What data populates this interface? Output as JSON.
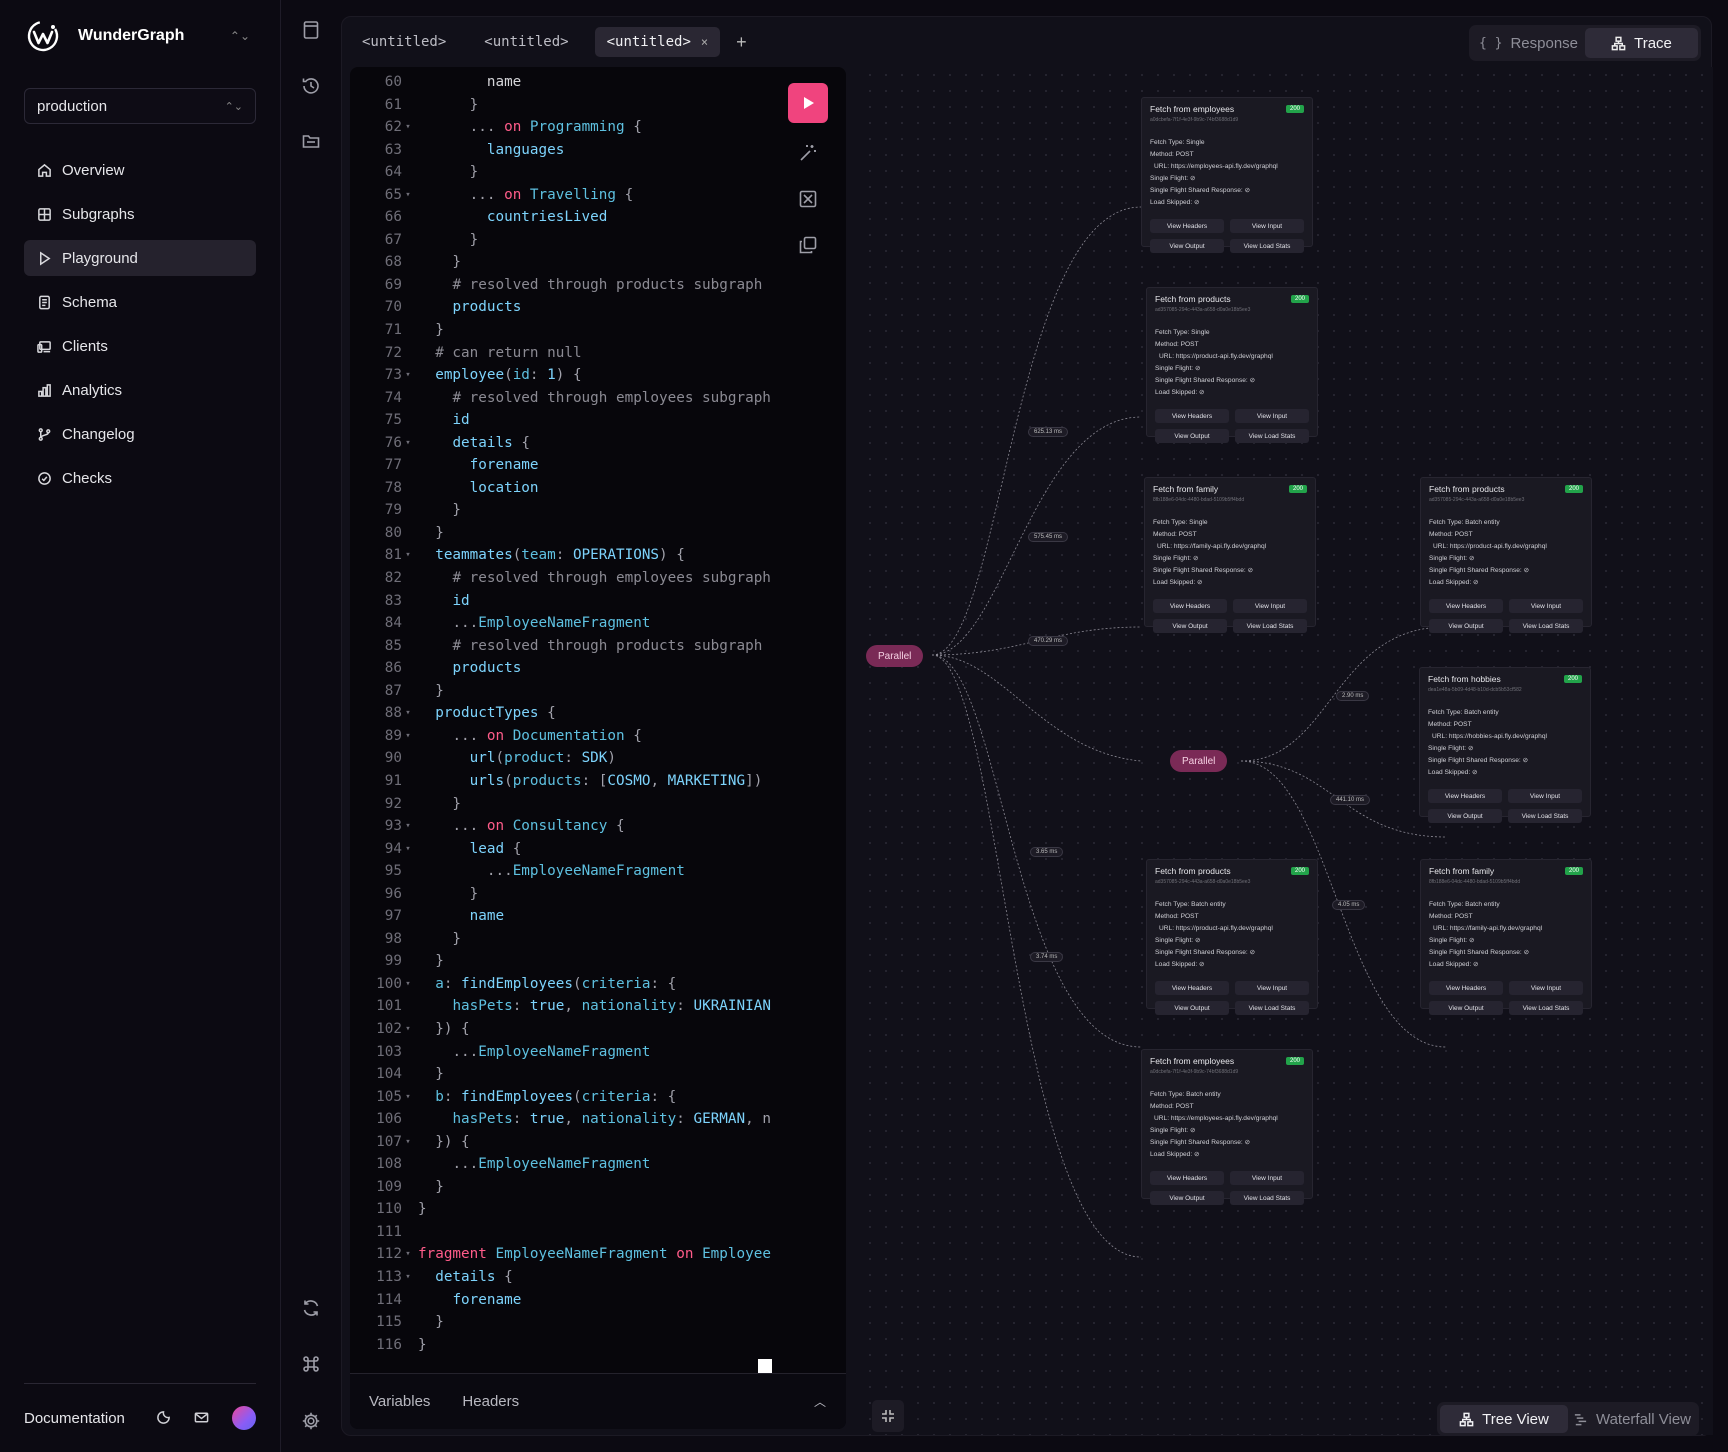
{
  "brand": {
    "name": "WunderGraph"
  },
  "environment": {
    "selected": "production"
  },
  "nav": [
    {
      "label": "Overview",
      "icon": "home-icon"
    },
    {
      "label": "Subgraphs",
      "icon": "grid-icon"
    },
    {
      "label": "Playground",
      "icon": "play-icon",
      "active": true
    },
    {
      "label": "Schema",
      "icon": "document-icon"
    },
    {
      "label": "Clients",
      "icon": "devices-icon"
    },
    {
      "label": "Analytics",
      "icon": "bar-chart-icon"
    },
    {
      "label": "Changelog",
      "icon": "git-branch-icon"
    },
    {
      "label": "Checks",
      "icon": "check-circle-icon"
    }
  ],
  "footer": {
    "documentation": "Documentation"
  },
  "tabs": [
    {
      "label": "<untitled>"
    },
    {
      "label": "<untitled>"
    },
    {
      "label": "<untitled>",
      "active": true,
      "close": "×"
    }
  ],
  "tab_add": "+",
  "result_toggle": {
    "response": "Response",
    "response_icon": "{ }",
    "trace": "Trace",
    "active": "Trace"
  },
  "editor": {
    "lines": [
      {
        "n": "60",
        "fold": false,
        "html": "<span class='p'>        name</span>"
      },
      {
        "n": "61",
        "fold": false,
        "html": "<span class='b'>      }</span>"
      },
      {
        "n": "62",
        "fold": true,
        "html": "      <span class='b'>... </span><span class='k'>on</span> <span class='f'>Programming</span> <span class='b'>{</span>"
      },
      {
        "n": "63",
        "fold": false,
        "html": "        <span class='t'>languages</span>"
      },
      {
        "n": "64",
        "fold": false,
        "html": "<span class='b'>      }</span>"
      },
      {
        "n": "65",
        "fold": true,
        "html": "      <span class='b'>... </span><span class='k'>on</span> <span class='f'>Travelling</span> <span class='b'>{</span>"
      },
      {
        "n": "66",
        "fold": false,
        "html": "        <span class='t'>countriesLived</span>"
      },
      {
        "n": "67",
        "fold": false,
        "html": "<span class='b'>      }</span>"
      },
      {
        "n": "68",
        "fold": false,
        "html": "<span class='b'>    }</span>"
      },
      {
        "n": "69",
        "fold": false,
        "html": "    <span class='c'># resolved through products subgraph</span>"
      },
      {
        "n": "70",
        "fold": false,
        "html": "    <span class='t'>products</span>"
      },
      {
        "n": "71",
        "fold": false,
        "html": "<span class='b'>  }</span>"
      },
      {
        "n": "72",
        "fold": false,
        "html": "  <span class='c'># can return null</span>"
      },
      {
        "n": "73",
        "fold": true,
        "html": "  <span class='t'>employee</span><span class='b'>(</span><span class='f'>id</span><span class='b'>: </span><span class='t'>1</span><span class='b'>) {</span>"
      },
      {
        "n": "74",
        "fold": false,
        "html": "    <span class='c'># resolved through employees subgraph</span>"
      },
      {
        "n": "75",
        "fold": false,
        "html": "    <span class='t'>id</span>"
      },
      {
        "n": "76",
        "fold": true,
        "html": "    <span class='t'>details</span> <span class='b'>{</span>"
      },
      {
        "n": "77",
        "fold": false,
        "html": "      <span class='t'>forename</span>"
      },
      {
        "n": "78",
        "fold": false,
        "html": "      <span class='t'>location</span>"
      },
      {
        "n": "79",
        "fold": false,
        "html": "<span class='b'>    }</span>"
      },
      {
        "n": "80",
        "fold": false,
        "html": "<span class='b'>  }</span>"
      },
      {
        "n": "81",
        "fold": true,
        "html": "  <span class='t'>teammates</span><span class='b'>(</span><span class='f'>team</span><span class='b'>: </span><span class='t'>OPERATIONS</span><span class='b'>) {</span>"
      },
      {
        "n": "82",
        "fold": false,
        "html": "    <span class='c'># resolved through employees subgraph</span>"
      },
      {
        "n": "83",
        "fold": false,
        "html": "    <span class='t'>id</span>"
      },
      {
        "n": "84",
        "fold": false,
        "html": "    <span class='b'>...</span><span class='f'>EmployeeNameFragment</span>"
      },
      {
        "n": "85",
        "fold": false,
        "html": "    <span class='c'># resolved through products subgraph</span>"
      },
      {
        "n": "86",
        "fold": false,
        "html": "    <span class='t'>products</span>"
      },
      {
        "n": "87",
        "fold": false,
        "html": "<span class='b'>  }</span>"
      },
      {
        "n": "88",
        "fold": true,
        "html": "  <span class='t'>productTypes</span> <span class='b'>{</span>"
      },
      {
        "n": "89",
        "fold": true,
        "html": "    <span class='b'>... </span><span class='k'>on</span> <span class='f'>Documentation</span> <span class='b'>{</span>"
      },
      {
        "n": "90",
        "fold": false,
        "html": "      <span class='t'>url</span><span class='b'>(</span><span class='f'>product</span><span class='b'>: </span><span class='t'>SDK</span><span class='b'>)</span>"
      },
      {
        "n": "91",
        "fold": false,
        "html": "      <span class='t'>urls</span><span class='b'>(</span><span class='f'>products</span><span class='b'>: [</span><span class='t'>COSMO</span><span class='b'>, </span><span class='t'>MARKETING</span><span class='b'>])</span>"
      },
      {
        "n": "92",
        "fold": false,
        "html": "<span class='b'>    }</span>"
      },
      {
        "n": "93",
        "fold": true,
        "html": "    <span class='b'>... </span><span class='k'>on</span> <span class='f'>Consultancy</span> <span class='b'>{</span>"
      },
      {
        "n": "94",
        "fold": true,
        "html": "      <span class='t'>lead</span> <span class='b'>{</span>"
      },
      {
        "n": "95",
        "fold": false,
        "html": "        <span class='b'>...</span><span class='f'>EmployeeNameFragment</span>"
      },
      {
        "n": "96",
        "fold": false,
        "html": "<span class='b'>      }</span>"
      },
      {
        "n": "97",
        "fold": false,
        "html": "      <span class='t'>name</span>"
      },
      {
        "n": "98",
        "fold": false,
        "html": "<span class='b'>    }</span>"
      },
      {
        "n": "99",
        "fold": false,
        "html": "<span class='b'>  }</span>"
      },
      {
        "n": "100",
        "fold": true,
        "html": "  <span class='f'>a</span><span class='b'>: </span><span class='t'>findEmployees</span><span class='b'>(</span><span class='f'>criteria</span><span class='b'>: {</span>"
      },
      {
        "n": "101",
        "fold": false,
        "html": "    <span class='f'>hasPets</span><span class='b'>: </span><span class='t'>true</span><span class='b'>, </span><span class='f'>nationality</span><span class='b'>: </span><span class='t'>UKRAINIAN</span>"
      },
      {
        "n": "102",
        "fold": true,
        "html": "<span class='b'>  }) {</span>"
      },
      {
        "n": "103",
        "fold": false,
        "html": "    <span class='b'>...</span><span class='f'>EmployeeNameFragment</span>"
      },
      {
        "n": "104",
        "fold": false,
        "html": "<span class='b'>  }</span>"
      },
      {
        "n": "105",
        "fold": true,
        "html": "  <span class='f'>b</span><span class='b'>: </span><span class='t'>findEmployees</span><span class='b'>(</span><span class='f'>criteria</span><span class='b'>: {</span>"
      },
      {
        "n": "106",
        "fold": false,
        "html": "    <span class='f'>hasPets</span><span class='b'>: </span><span class='t'>true</span><span class='b'>, </span><span class='f'>nationality</span><span class='b'>: </span><span class='t'>GERMAN</span><span class='b'>, n</span>"
      },
      {
        "n": "107",
        "fold": true,
        "html": "<span class='b'>  }) {</span>"
      },
      {
        "n": "108",
        "fold": false,
        "html": "    <span class='b'>...</span><span class='f'>EmployeeNameFragment</span>"
      },
      {
        "n": "109",
        "fold": false,
        "html": "<span class='b'>  }</span>"
      },
      {
        "n": "110",
        "fold": false,
        "html": "<span class='b'>}</span>"
      },
      {
        "n": "111",
        "fold": false,
        "html": ""
      },
      {
        "n": "112",
        "fold": true,
        "html": "<span class='k'>fragment</span> <span class='f'>EmployeeNameFragment</span> <span class='k'>on</span> <span class='f'>Employee</span> <span class='b'>{</span>"
      },
      {
        "n": "113",
        "fold": true,
        "html": "  <span class='t'>details</span> <span class='b'>{</span>"
      },
      {
        "n": "114",
        "fold": false,
        "html": "    <span class='t'>forename</span>"
      },
      {
        "n": "115",
        "fold": false,
        "html": "<span class='b'>  }</span>"
      },
      {
        "n": "116",
        "fold": false,
        "html": "<span class='b'>}</span>"
      }
    ],
    "bottom_tabs": [
      "Variables",
      "Headers"
    ]
  },
  "trace": {
    "parallel_label": "Parallel",
    "nodes": [
      {
        "title": "Fetch from employees",
        "status": "200",
        "id": "a0dcbefa-7f1f-4e3f-9b9c-74bf3688d1d9",
        "fetch_type": "Fetch Type: Single",
        "method": "Method: POST",
        "url": "URL: https://employees-api.fly.dev/graphql",
        "single_flight": "Single Flight:",
        "shared": "Single Flight Shared Response:",
        "skipped": "Load Skipped:"
      },
      {
        "title": "Fetch from products",
        "status": "200",
        "id": "ad357085-294c-443a-a658-d0a0e18b5ee3",
        "fetch_type": "Fetch Type: Single",
        "method": "Method: POST",
        "url": "URL: https://product-api.fly.dev/graphql",
        "single_flight": "Single Flight:",
        "shared": "Single Flight Shared Response:",
        "skipped": "Load Skipped:"
      },
      {
        "title": "Fetch from family",
        "status": "200",
        "id": "8fb188e6-04dc-4480-bdad-5109b5ff4bdd",
        "fetch_type": "Fetch Type: Single",
        "method": "Method: POST",
        "url": "URL: https://family-api.fly.dev/graphql",
        "single_flight": "Single Flight:",
        "shared": "Single Flight Shared Response:",
        "skipped": "Load Skipped:"
      },
      {
        "title": "Fetch from products",
        "status": "200",
        "id": "ad357085-294c-443a-a658-d0a0e18b5ee3",
        "fetch_type": "Fetch Type: Batch entity",
        "method": "Method: POST",
        "url": "URL: https://product-api.fly.dev/graphql",
        "single_flight": "Single Flight:",
        "shared": "Single Flight Shared Response:",
        "skipped": "Load Skipped:"
      },
      {
        "title": "Fetch from hobbies",
        "status": "200",
        "id": "dea1e48a-5b09-4d48-b10d-dcb5b53cf582",
        "fetch_type": "Fetch Type: Batch entity",
        "method": "Method: POST",
        "url": "URL: https://hobbies-api.fly.dev/graphql",
        "single_flight": "Single Flight:",
        "shared": "Single Flight Shared Response:",
        "skipped": "Load Skipped:"
      },
      {
        "title": "Fetch from products",
        "status": "200",
        "id": "ad357085-294c-443a-a658-d0a0e18b5ee3",
        "fetch_type": "Fetch Type: Batch entity",
        "method": "Method: POST",
        "url": "URL: https://product-api.fly.dev/graphql",
        "single_flight": "Single Flight:",
        "shared": "Single Flight Shared Response:",
        "skipped": "Load Skipped:"
      },
      {
        "title": "Fetch from family",
        "status": "200",
        "id": "8fb188e6-04dc-4480-bdad-5109b5ff4bdd",
        "fetch_type": "Fetch Type: Batch entity",
        "method": "Method: POST",
        "url": "URL: https://family-api.fly.dev/graphql",
        "single_flight": "Single Flight:",
        "shared": "Single Flight Shared Response:",
        "skipped": "Load Skipped:"
      },
      {
        "title": "Fetch from employees",
        "status": "200",
        "id": "a0dcbefa-7f1f-4e3f-9b9c-74bf3688d1d9",
        "fetch_type": "Fetch Type: Batch entity",
        "method": "Method: POST",
        "url": "URL: https://employees-api.fly.dev/graphql",
        "single_flight": "Single Flight:",
        "shared": "Single Flight Shared Response:",
        "skipped": "Load Skipped:"
      }
    ],
    "buttons": {
      "headers": "View Headers",
      "input": "View Input",
      "output": "View Output",
      "load_stats": "View Load Stats"
    },
    "edge_labels": [
      "625.13 ms",
      "575.45 ms",
      "470.29 ms",
      "3.65 ms",
      "3.74 ms",
      "2.90 ms",
      "441.10 ms",
      "4.05 ms"
    ]
  },
  "view_toggle": {
    "tree": "Tree View",
    "waterfall": "Waterfall View",
    "active": "Tree View"
  }
}
